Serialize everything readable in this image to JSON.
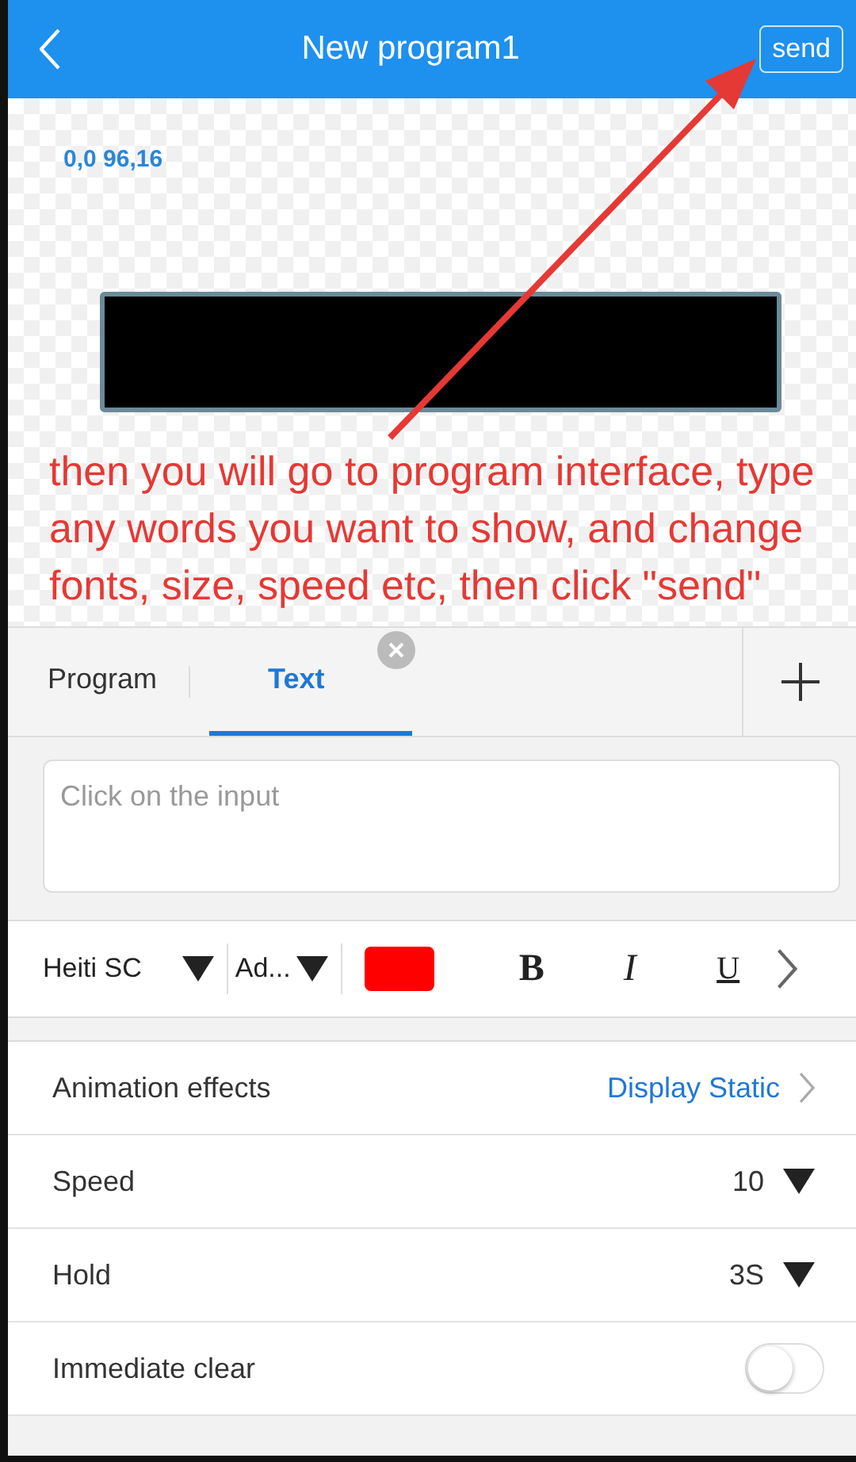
{
  "header": {
    "title": "New program1",
    "action": "send"
  },
  "canvas": {
    "coordinates": "0,0 96,16"
  },
  "annotation": {
    "text": "then you will go to program interface, type any words you want to show, and change fonts, size, speed etc, then click \"send\""
  },
  "tabs": [
    {
      "label": "Program",
      "selected": false,
      "closable": false
    },
    {
      "label": "Text",
      "selected": true,
      "closable": true
    }
  ],
  "input": {
    "placeholder": "Click on the input"
  },
  "toolbar": {
    "font": "Heiti SC",
    "size": "Ad...",
    "color": "#ff0000",
    "bold": "B",
    "italic": "I",
    "underline": "U"
  },
  "settings": [
    {
      "kind": "link",
      "label": "Animation effects",
      "value": "Display Static"
    },
    {
      "kind": "dropdown",
      "label": "Speed",
      "value": "10"
    },
    {
      "kind": "dropdown",
      "label": "Hold",
      "value": "3S"
    },
    {
      "kind": "toggle",
      "label": "Immediate clear",
      "on": false
    }
  ]
}
